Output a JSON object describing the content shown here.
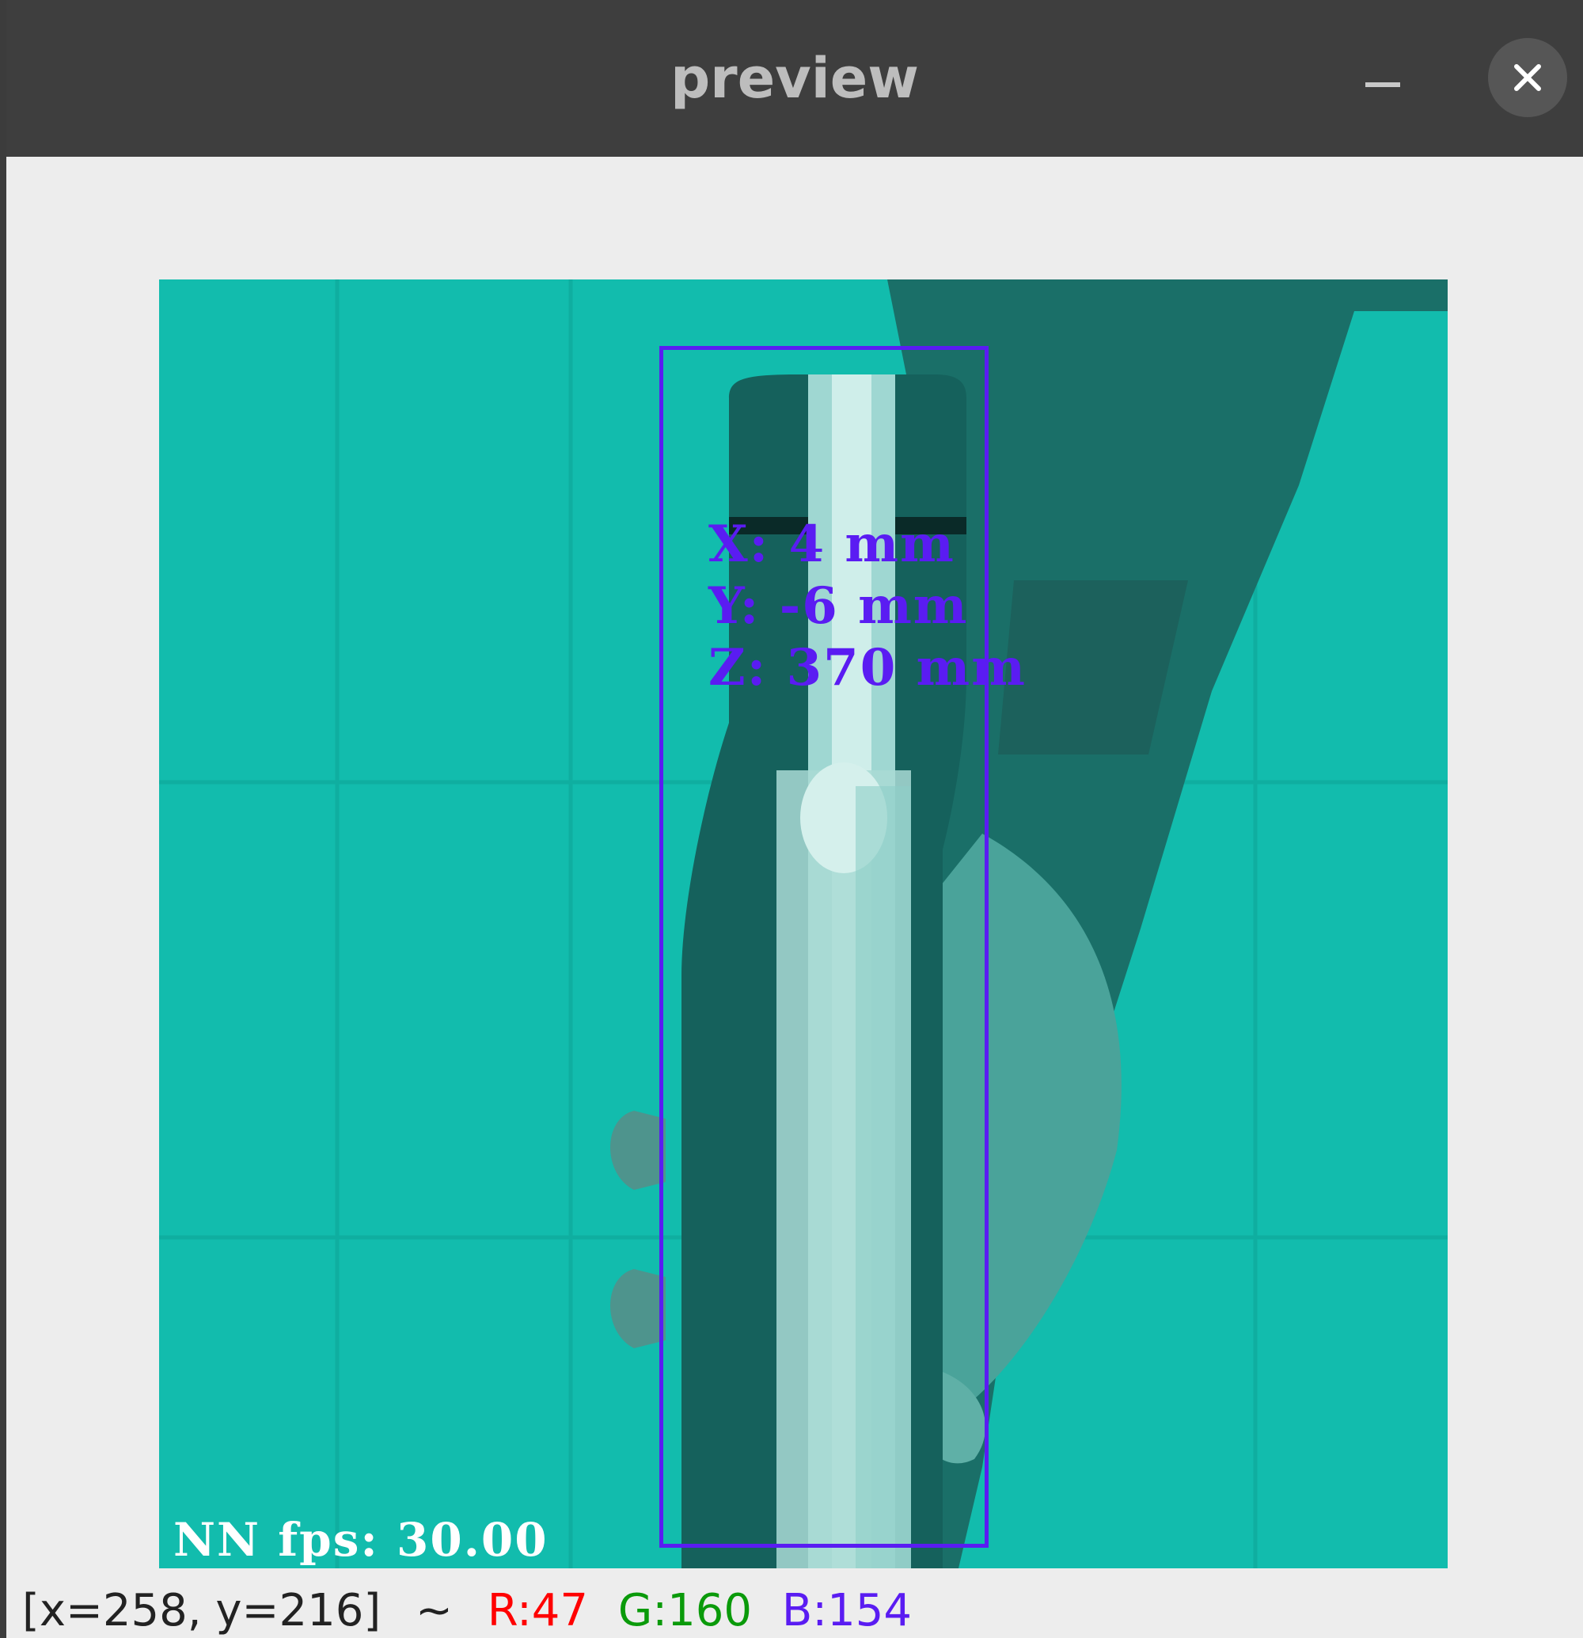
{
  "window": {
    "title": "preview",
    "minimize_icon": "minimize-icon",
    "close_icon": "close-icon"
  },
  "overlay": {
    "x_label": "X: 4 mm",
    "y_label": "Y: -6 mm",
    "z_label": "Z: 370 mm",
    "fps_label": "NN fps: 30.00",
    "bbox_color": "#5a1cf2"
  },
  "status": {
    "position": "[x=258, y=216]",
    "separator": "~",
    "r": "R:47",
    "g": "G:160",
    "b": "B:154"
  },
  "colors": {
    "background_teal": "#12bcad",
    "r_color": "#ff0000",
    "g_color": "#0a9a0a",
    "b_color": "#5a1cf2"
  }
}
